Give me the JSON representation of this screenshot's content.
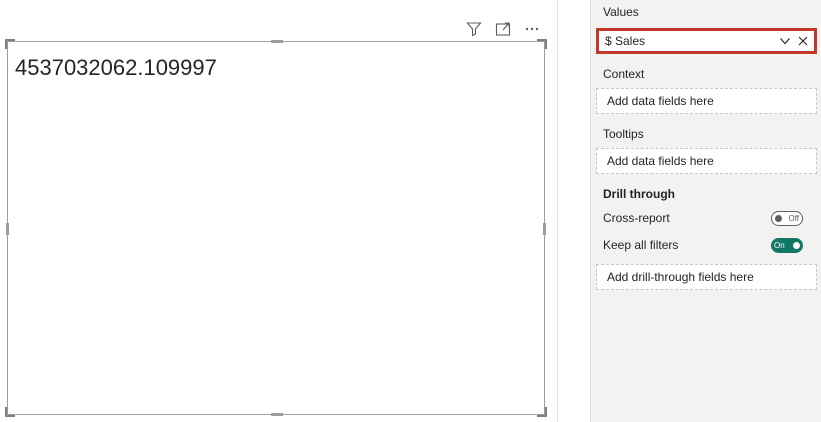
{
  "visual": {
    "value": "4537032062.109997",
    "toolbar": {
      "filter_icon": "filter-icon",
      "focus_icon": "focus-mode-icon",
      "more_icon": "more-options-icon"
    }
  },
  "pane": {
    "values_label": "Values",
    "values_field": "$ Sales",
    "context_label": "Context",
    "context_placeholder": "Add data fields here",
    "tooltips_label": "Tooltips",
    "tooltips_placeholder": "Add data fields here",
    "drill_through_label": "Drill through",
    "cross_report_label": "Cross-report",
    "cross_report_state": "Off",
    "keep_filters_label": "Keep all filters",
    "keep_filters_state": "On",
    "drill_placeholder": "Add drill-through fields here"
  },
  "colors": {
    "highlight": "#c0392b",
    "toggle_on": "#117865"
  }
}
